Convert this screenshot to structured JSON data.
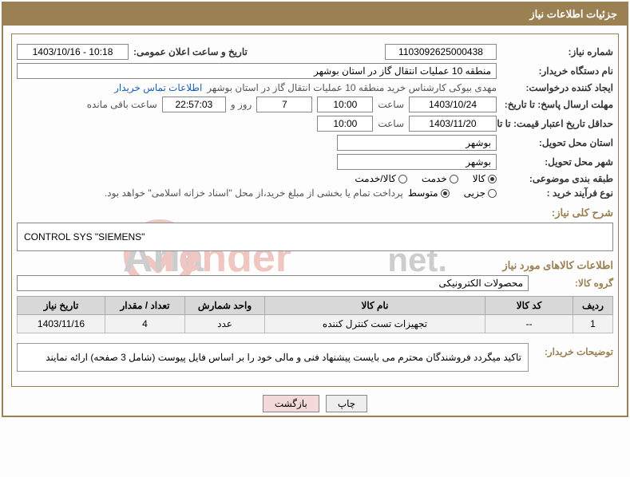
{
  "header": {
    "title": "جزئیات اطلاعات نیاز"
  },
  "need_number": {
    "label": "شماره نیاز:",
    "value": "1103092625000438"
  },
  "announce": {
    "label": "تاریخ و ساعت اعلان عمومی:",
    "value": "1403/10/16 - 10:18"
  },
  "buyer_org": {
    "label": "نام دستگاه خریدار:",
    "value": "منطقه 10 عملیات انتقال گاز در استان بوشهر"
  },
  "requestor": {
    "label": "ایجاد کننده درخواست:",
    "value": "مهدی بیوکی کارشناس خرید منطقه 10 عملیات انتقال گاز در استان بوشهر",
    "link": "اطلاعات تماس خریدار"
  },
  "deadline_reply": {
    "label": "مهلت ارسال پاسخ: تا تاریخ:",
    "date": "1403/10/24",
    "time_label": "ساعت",
    "time": "10:00",
    "days": "7",
    "days_label": "روز و",
    "countdown": "22:57:03",
    "remaining_label": "ساعت باقی مانده"
  },
  "min_validity": {
    "label": "حداقل تاریخ اعتبار قیمت: تا تاریخ:",
    "date": "1403/11/20",
    "time_label": "ساعت",
    "time": "10:00"
  },
  "province_delivery": {
    "label": "استان محل تحویل:",
    "value": "بوشهر"
  },
  "city_delivery": {
    "label": "شهر محل تحویل:",
    "value": "بوشهر"
  },
  "category": {
    "label": "طبقه بندی موضوعی:",
    "options": [
      "کالا",
      "خدمت",
      "کالا/خدمت"
    ],
    "selected": 0
  },
  "process": {
    "label": "نوع فرآیند خرید :",
    "options": [
      "جزیی",
      "متوسط"
    ],
    "selected": 1,
    "note": "پرداخت تمام یا بخشی از مبلغ خرید،از محل \"اسناد خزانه اسلامی\" خواهد بود."
  },
  "overall_need": {
    "label": "شرح کلی نیاز:",
    "value": "CONTROL SYS \"SIEMENS\""
  },
  "goods_section": "اطلاعات کالاهای مورد نیاز",
  "goods_group": {
    "label": "گروه کالا:",
    "value": "محصولات الکترونیکی"
  },
  "table": {
    "headers": [
      "ردیف",
      "کد کالا",
      "نام کالا",
      "واحد شمارش",
      "تعداد / مقدار",
      "تاریخ نیاز"
    ],
    "rows": [
      {
        "idx": "1",
        "code": "--",
        "name": "تجهیزات تست کنترل کننده",
        "unit": "عدد",
        "qty": "4",
        "date": "1403/11/16"
      }
    ]
  },
  "buyer_note": {
    "label": "توضیحات خریدار:",
    "text": "تاکید میگردد فروشندگان محترم می بایست پیشنهاد فنی و مالی خود را بر اساس فایل پیوست (شامل 3 صفحه) ارائه نمایند"
  },
  "buttons": {
    "print": "چاپ",
    "back": "بازگشت"
  },
  "watermark": {
    "text_a": "Aria",
    "text_b": "Tender",
    "text_c": ".net"
  }
}
